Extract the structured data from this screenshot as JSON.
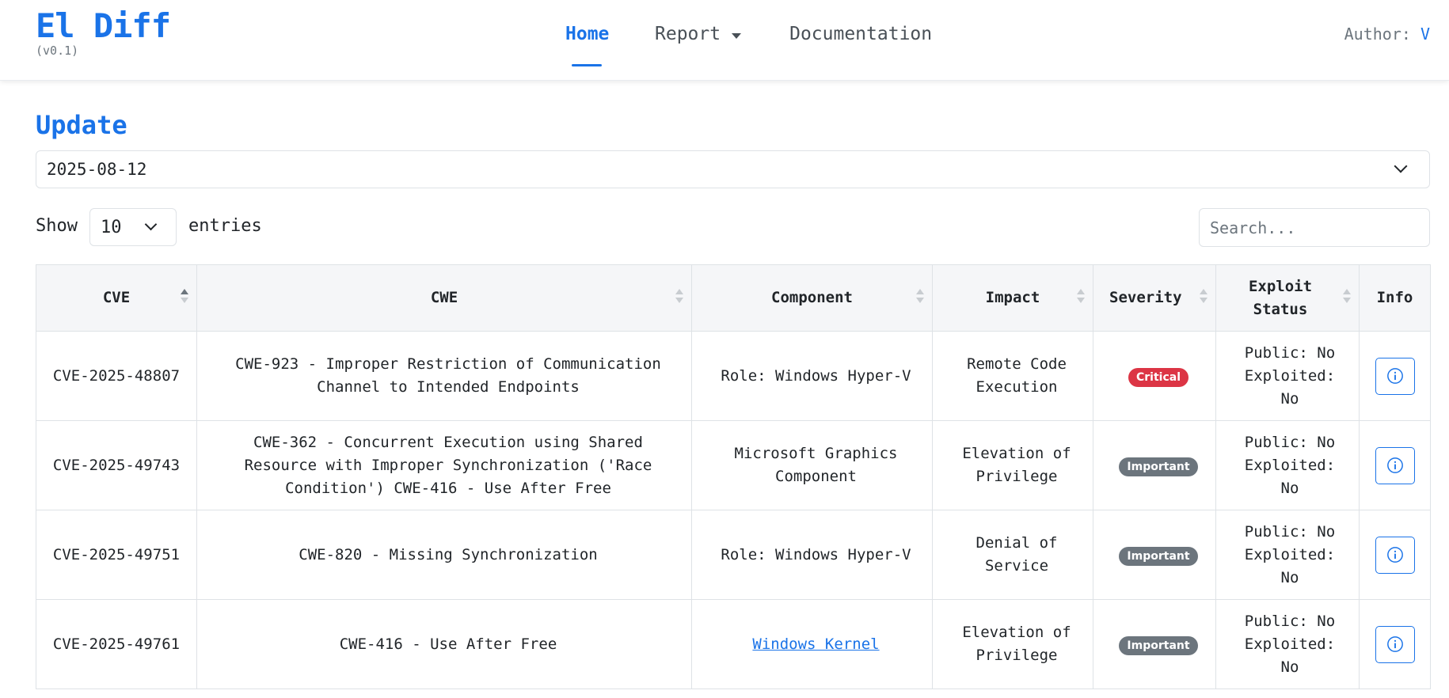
{
  "brand": {
    "title": "El Diff",
    "version": "(v0.1)"
  },
  "nav": {
    "home": "Home",
    "report": "Report",
    "documentation": "Documentation"
  },
  "author": {
    "label": "Author:",
    "name": "V"
  },
  "update": {
    "title": "Update",
    "selected_date": "2025-08-12"
  },
  "controls": {
    "show": "Show",
    "page_length": "10",
    "entries": "entries",
    "search_placeholder": "Search..."
  },
  "table": {
    "headers": [
      "CVE",
      "CWE",
      "Component",
      "Impact",
      "Severity",
      "Exploit Status",
      "Info"
    ],
    "rows": [
      {
        "cve": "CVE-2025-48807",
        "cwe": "CWE-923 - Improper Restriction of Communication Channel to Intended Endpoints",
        "component": "Role: Windows Hyper-V",
        "component_is_link": false,
        "impact": "Remote Code Execution",
        "severity": "Critical",
        "public": "Public: No",
        "exploited": "Exploited: No"
      },
      {
        "cve": "CVE-2025-49743",
        "cwe": "CWE-362 - Concurrent Execution using Shared Resource with Improper Synchronization ('Race Condition') CWE-416 - Use After Free",
        "component": "Microsoft Graphics Component",
        "component_is_link": false,
        "impact": "Elevation of Privilege",
        "severity": "Important",
        "public": "Public: No",
        "exploited": "Exploited: No"
      },
      {
        "cve": "CVE-2025-49751",
        "cwe": "CWE-820 - Missing Synchronization",
        "component": "Role: Windows Hyper-V",
        "component_is_link": false,
        "impact": "Denial of Service",
        "severity": "Important",
        "public": "Public: No",
        "exploited": "Exploited: No"
      },
      {
        "cve": "CVE-2025-49761",
        "cwe": "CWE-416 - Use After Free",
        "component": "Windows Kernel",
        "component_is_link": true,
        "impact": "Elevation of Privilege",
        "severity": "Important",
        "public": "Public: No",
        "exploited": "Exploited: No"
      }
    ]
  },
  "colors": {
    "accent": "#1a73e8",
    "critical": "#dc3545",
    "important": "#6c757d"
  },
  "icons": {
    "info": "info-circle-icon",
    "select": "chevron-down-icon",
    "report": "caret-down-icon"
  }
}
